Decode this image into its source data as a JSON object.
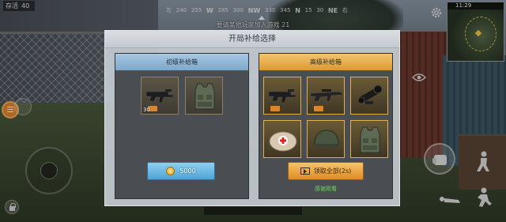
{
  "hud": {
    "survivors_label": "存活",
    "survivors_count": "40",
    "compass": [
      "左",
      "240",
      "255",
      "W",
      "285",
      "300",
      "NW",
      "330",
      "345",
      "N",
      "15",
      "30",
      "NE",
      "右"
    ],
    "notice": "要请某他玩家加入游戏  21",
    "clock": "11:29"
  },
  "modal": {
    "title": "开局补给选择",
    "basic": {
      "title": "初级补给箱",
      "items": [
        {
          "icon": "smg-icon",
          "qty": "30"
        },
        {
          "icon": "vest-icon",
          "qty": ""
        }
      ],
      "button_label": "5000"
    },
    "premium": {
      "title": "高级补给箱",
      "items": [
        {
          "icon": "smg-icon",
          "qty": ""
        },
        {
          "icon": "rifle-icon",
          "qty": ""
        },
        {
          "icon": "scope-icon",
          "qty": ""
        },
        {
          "icon": "first-aid-kit-icon",
          "qty": ""
        },
        {
          "icon": "helmet-icon",
          "qty": ""
        },
        {
          "icon": "vest-icon",
          "qty": ""
        }
      ],
      "button_label": "领取全部(2s)",
      "thanks_text": "感谢观看"
    }
  },
  "colors": {
    "basic_header": "#7ea8ca",
    "premium_header": "#dc9a33",
    "thanks_text": "#6fdb54"
  }
}
